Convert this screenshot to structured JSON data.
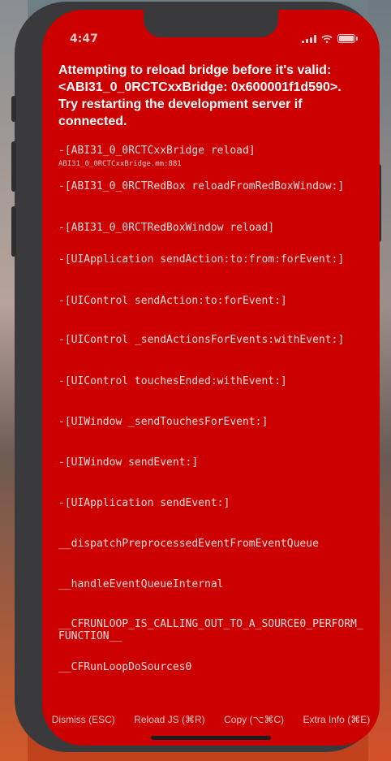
{
  "status_bar": {
    "time": "4:47"
  },
  "redbox": {
    "title": "Attempting to reload bridge before it's valid: <ABI31_0_0RCTCxxBridge: 0x600001f1d590>. Try restarting the development server if connected.",
    "frames": [
      {
        "method": "-[ABI31_0_0RCTCxxBridge reload]",
        "file": "ABI31_0_0RCTCxxBridge.mm:881"
      },
      {
        "method": "-[ABI31_0_0RCTRedBox reloadFromRedBoxWindow:]"
      },
      {
        "method": "-[ABI31_0_0RCTRedBoxWindow reload]"
      },
      {
        "method": "-[UIApplication sendAction:to:from:forEvent:]"
      },
      {
        "method": "-[UIControl sendAction:to:forEvent:]"
      },
      {
        "method": "-[UIControl _sendActionsForEvents:withEvent:]"
      },
      {
        "method": "-[UIControl touchesEnded:withEvent:]"
      },
      {
        "method": "-[UIWindow _sendTouchesForEvent:]"
      },
      {
        "method": "-[UIWindow sendEvent:]"
      },
      {
        "method": "-[UIApplication sendEvent:]"
      },
      {
        "method": "__dispatchPreprocessedEventFromEventQueue"
      },
      {
        "method": "__handleEventQueueInternal"
      },
      {
        "method": "__CFRUNLOOP_IS_CALLING_OUT_TO_A_SOURCE0_PERFORM_FUNCTION__"
      },
      {
        "method": "__CFRunLoopDoSources0"
      }
    ],
    "buttons": {
      "dismiss": "Dismiss (ESC)",
      "reload": "Reload JS (⌘R)",
      "copy": "Copy (⌥⌘C)",
      "extra": "Extra Info (⌘E)"
    }
  },
  "colors": {
    "redbox_bg": "#cc0000",
    "phone_frame": "#3a3a3c"
  },
  "icons": [
    "signal-icon",
    "wifi-icon",
    "battery-icon"
  ]
}
